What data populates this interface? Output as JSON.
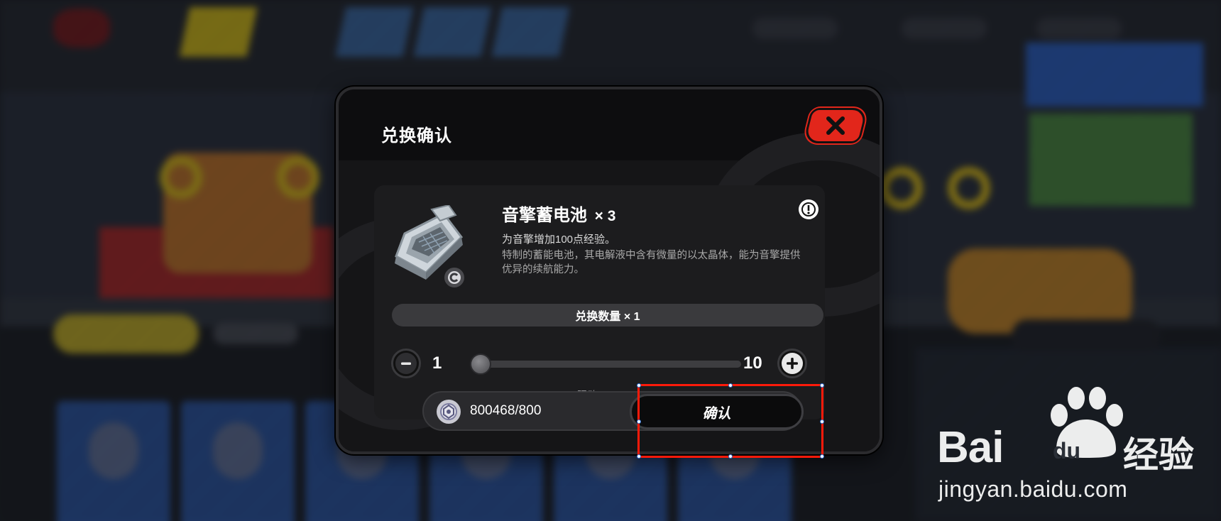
{
  "dialog": {
    "title": "兑换确认",
    "close_icon": "close-x-icon",
    "accent_color": "#e2261b"
  },
  "item": {
    "name": "音擎蓄电池",
    "count_label": "× 3",
    "icon": "battery-device-icon",
    "effect": "为音擎增加100点经验。",
    "flavor": "特制的蓄能电池，其电解液中含有微量的以太晶体，能为音擎提供优异的续航能力。"
  },
  "exchange": {
    "quantity_label": "兑换数量 × 1",
    "min_value": "1",
    "max_value": "10",
    "current_quantity": 1,
    "limit_text": "限购 × 10"
  },
  "footer": {
    "currency_icon": "gear-coin-icon",
    "balance": "800468/800",
    "confirm_label": "确认"
  },
  "watermark": {
    "brand_prefix": "Bai",
    "brand_du": "du",
    "brand_suffix": "经验",
    "url": "jingyan.baidu.com"
  },
  "annotation": {
    "highlight_color": "#ff1a0a"
  }
}
